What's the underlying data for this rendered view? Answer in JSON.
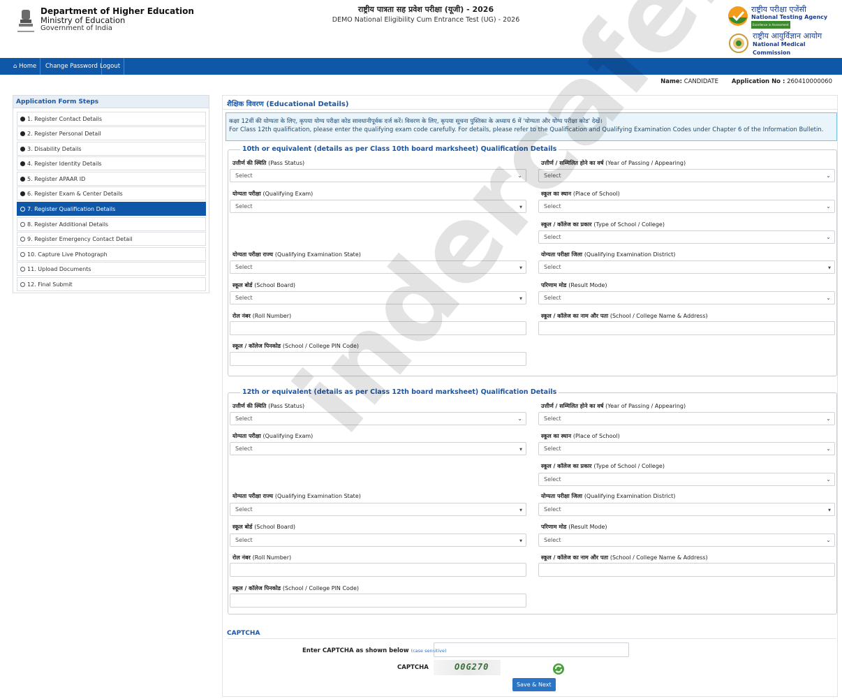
{
  "header": {
    "dept_title": "Department of Higher Education",
    "ministry": "Ministry of Education",
    "govt": "Government of India",
    "exam_hindi": "राष्ट्रीय पात्रता सह प्रवेश परीक्षा (यूजी) - 2026",
    "exam_english": "DEMO National Eligibility Cum Entrance Test (UG) - 2026",
    "nta_hindi": "राष्ट्रीय परीक्षा एजेंसी",
    "nta_english": "National Testing Agency",
    "nta_tagline": "Excellence in Assessment",
    "nmc_hindi": "राष्ट्रीय आयुर्विज्ञान आयोग",
    "nmc_english": "National Medical Commission"
  },
  "nav": {
    "home": "Home",
    "change_password": "Change Password",
    "logout": "Logout"
  },
  "user": {
    "name_label": "Name:",
    "name": "CANDIDATE",
    "app_label": "Application No :",
    "app_no": "260410000060"
  },
  "sidebar": {
    "title": "Application Form Steps",
    "steps": [
      "1. Register Contact Details",
      "2. Register Personal Detail",
      "3. Disability Details",
      "4. Register Identity Details",
      "5. Register APAAR ID",
      "6. Register Exam & Center Details",
      "7. Register Qualification Details",
      "8. Register Additional Details",
      "9. Register Emergency Contact Detail",
      "10. Capture Live Photograph",
      "11. Upload Documents",
      "12. Final Submit"
    ]
  },
  "page": {
    "title": "शैक्षिक विवरण (Educational Details)",
    "info_hindi": "कक्षा 12वीं की योग्यता के लिए, कृपया योग्य परीक्षा कोड सावधानीपूर्वक दर्ज करें। विवरण के लिए, कृपया सूचना पुस्तिका के अध्याय 6 में 'योग्यता और योग्य परीक्षा कोड' देखें।",
    "info_english": "For Class 12th qualification, please enter the qualifying exam code carefully. For details, please refer to the Qualification and Qualifying Examination Codes under Chapter 6 of the Information Bulletin."
  },
  "labels": {
    "pass_status_hi": "उत्तीर्ण की स्थिति",
    "pass_status_en": "(Pass Status)",
    "year_hi": "उत्तीर्ण / सम्मिलित होने का वर्ष",
    "year_en": "(Year of Passing / Appearing)",
    "qual_exam_hi": "योग्यता परीक्षा",
    "qual_exam_en": "(Qualifying Exam)",
    "place_hi": "स्कूल का स्थान",
    "place_en": "(Place of School)",
    "type_hi": "स्कूल / कॉलेज का प्रकार",
    "type_en": "(Type of School / College)",
    "state_hi": "योग्यता परीक्षा राज्य",
    "state_en": "(Qualifying Examination State)",
    "district_hi": "योग्यता परीक्षा जिला",
    "district_en": "(Qualifying Examination District)",
    "board_hi": "स्कूल बोर्ड",
    "board_en": "(School Board)",
    "result_hi": "परिणाम मोड",
    "result_en": "(Result Mode)",
    "roll_hi": "रोल नंबर",
    "roll_en": "(Roll Number)",
    "address_hi": "स्कूल / कॉलेज का नाम और पता",
    "address_en": "(School / College Name & Address)",
    "pin_hi": "स्कूल / कॉलेज पिनकोड",
    "pin_en": "(School / College PIN Code)",
    "select": "Select"
  },
  "section10": {
    "legend": "10th or equivalent (details as per Class 10th board marksheet) Qualification Details"
  },
  "section12": {
    "legend": "12th or equivalent (details as per Class 12th board marksheet) Qualification Details"
  },
  "captcha": {
    "title": "CAPTCHA",
    "enter_label": "Enter CAPTCHA as shown below",
    "case_note": "(case sensitive)",
    "captcha_label": "CAPTCHA",
    "code": "O0G270"
  },
  "submit_label": "Save & Next",
  "watermark": "indercafe.com"
}
